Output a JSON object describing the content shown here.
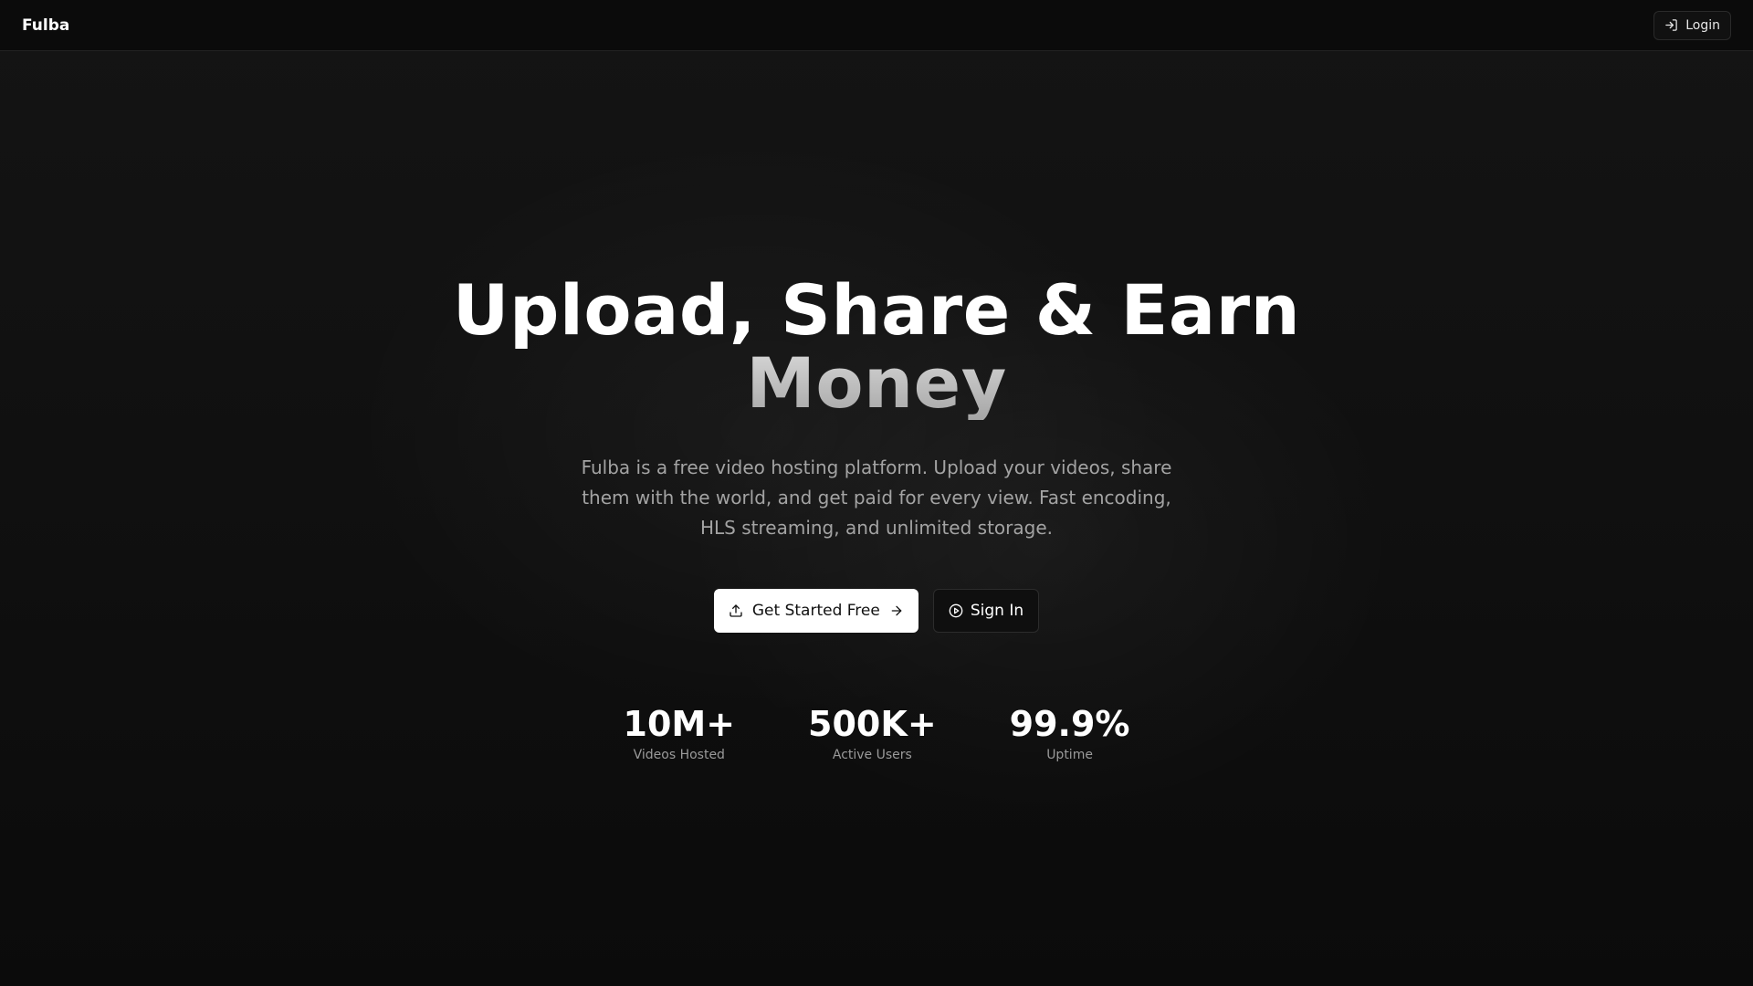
{
  "header": {
    "brand": "Fulba",
    "login_label": "Login",
    "login_icon": "log-in-icon"
  },
  "hero": {
    "headline_line1": "Upload, Share & Earn",
    "headline_line2": "Money",
    "subtitle": "Fulba is a free video hosting platform. Upload your videos, share them with the world, and get paid for every view. Fast encoding, HLS streaming, and unlimited storage.",
    "primary_cta": {
      "label": "Get Started Free",
      "icon_left": "upload-icon",
      "icon_right": "arrow-right-icon"
    },
    "secondary_cta": {
      "label": "Sign In",
      "icon": "play-circle-icon"
    }
  },
  "stats": [
    {
      "value": "10M+",
      "label": "Videos Hosted"
    },
    {
      "value": "500K+",
      "label": "Active Users"
    },
    {
      "value": "99.9%",
      "label": "Uptime"
    }
  ],
  "colors": {
    "background": "#0a0a0a",
    "text_primary": "#ffffff",
    "text_muted": "#a3a3a3",
    "primary_button_bg": "#ffffff",
    "primary_button_text": "#111111"
  }
}
